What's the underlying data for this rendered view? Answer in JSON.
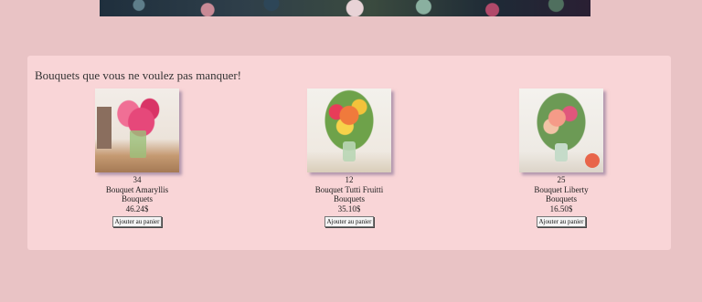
{
  "section": {
    "title": "Bouquets que vous ne voulez pas manquer!"
  },
  "products": [
    {
      "quantity": "34",
      "name": "Bouquet Amaryllis",
      "category": "Bouquets",
      "price": "46.24$",
      "button_label": "Ajouter au panier"
    },
    {
      "quantity": "12",
      "name": "Bouquet Tutti Fruitti",
      "category": "Bouquets",
      "price": "35.10$",
      "button_label": "Ajouter au panier"
    },
    {
      "quantity": "25",
      "name": "Bouquet Liberty",
      "category": "Bouquets",
      "price": "16.50$",
      "button_label": "Ajouter au panier"
    }
  ]
}
